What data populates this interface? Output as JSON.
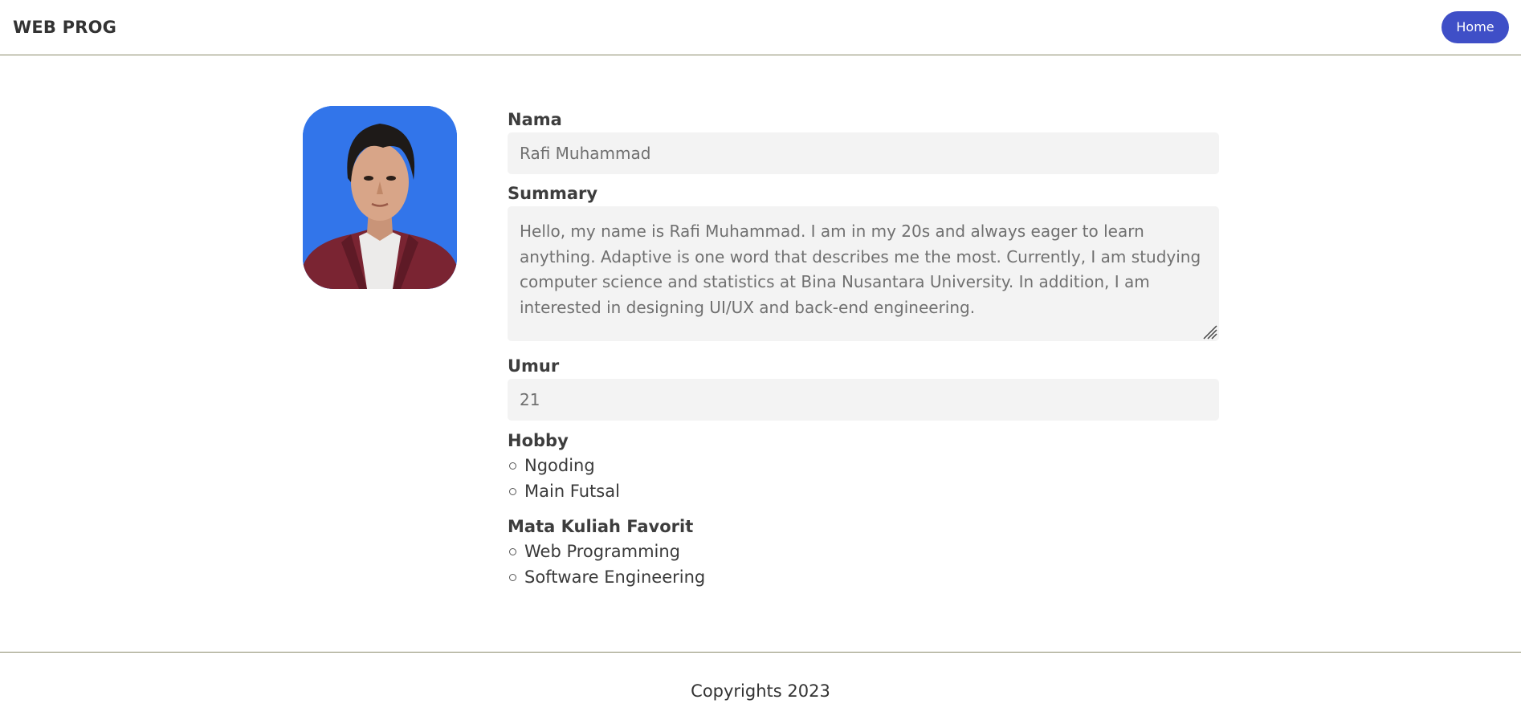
{
  "header": {
    "brand": "WEB PROG",
    "nav_button": "Home",
    "nav_button_color": "#3f4fc7"
  },
  "profile": {
    "photo_icon": "profile-photo",
    "nama_label": "Nama",
    "nama_value": "Rafi Muhammad",
    "summary_label": "Summary",
    "summary_value": "Hello, my name is Rafi Muhammad. I am in my 20s and always eager to learn anything. Adaptive is one word that describes me the most. Currently, I am studying computer science and statistics at Bina Nusantara University. In addition, I am interested in designing UI/UX and back-end engineering.",
    "umur_label": "Umur",
    "umur_value": "21",
    "hobby_label": "Hobby",
    "hobbies": [
      "Ngoding",
      "Main Futsal"
    ],
    "courses_label": "Mata Kuliah Favorit",
    "courses": [
      "Web Programming",
      "Software Engineering"
    ]
  },
  "footer": {
    "copyright": "Copyrights 2023"
  }
}
